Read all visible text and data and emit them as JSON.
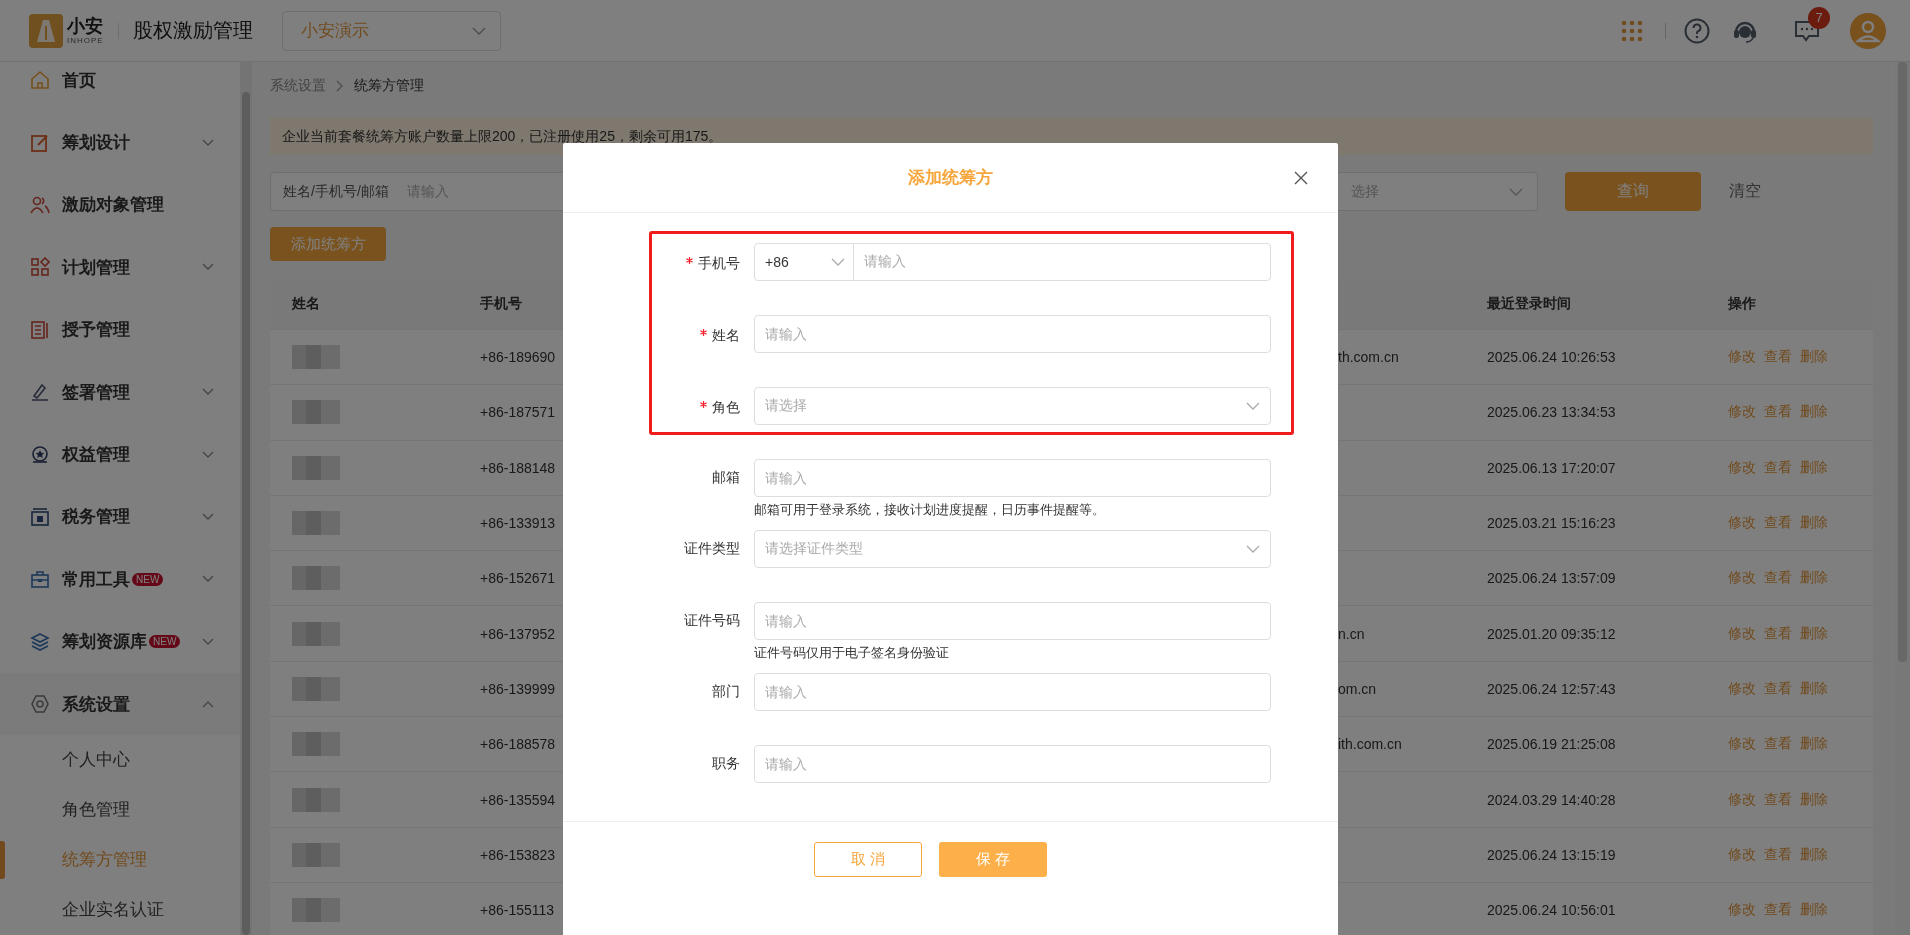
{
  "header": {
    "logo_text": "小安",
    "logo_subtext": "INHOPE",
    "app_title": "股权激励管理",
    "company_select": {
      "value": "小安演示"
    },
    "message_count": "7"
  },
  "sidebar": {
    "items": [
      {
        "label": "首页"
      },
      {
        "label": "筹划设计",
        "expanded": false
      },
      {
        "label": "激励对象管理"
      },
      {
        "label": "计划管理",
        "expanded": false
      },
      {
        "label": "授予管理"
      },
      {
        "label": "签署管理",
        "expanded": false
      },
      {
        "label": "权益管理",
        "expanded": false
      },
      {
        "label": "税务管理",
        "expanded": false
      },
      {
        "label": "常用工具",
        "badge": "NEW",
        "expanded": false
      },
      {
        "label": "筹划资源库",
        "badge": "NEW",
        "expanded": false
      },
      {
        "label": "系统设置",
        "expanded": true,
        "children": [
          {
            "label": "个人中心",
            "selected": false
          },
          {
            "label": "角色管理",
            "selected": false
          },
          {
            "label": "统筹方管理",
            "selected": true
          },
          {
            "label": "企业实名认证",
            "selected": false
          }
        ]
      }
    ]
  },
  "breadcrumb": [
    "系统设置",
    "统筹方管理"
  ],
  "notice": "企业当前套餐统筹方账户数量上限200，已注册使用25，剩余可用175。",
  "filters": {
    "search_label": "姓名/手机号/邮箱",
    "search_placeholder": "请输入",
    "select_placeholder": "选择",
    "query_button": "查询",
    "clear_button": "清空"
  },
  "add_button": "添加统筹方",
  "table": {
    "columns": {
      "name": "姓名",
      "phone": "手机号",
      "last_login": "最近登录时间",
      "actions": "操作"
    },
    "rows": [
      {
        "phone": "+86-189690",
        "email": "th.com.cn",
        "last_login": "2025.06.24 10:26:53",
        "actions": [
          "修改",
          "查看",
          "删除"
        ]
      },
      {
        "phone": "+86-187571",
        "last_login": "2025.06.23 13:34:53",
        "actions": [
          "修改",
          "查看",
          "删除"
        ]
      },
      {
        "phone": "+86-188148",
        "last_login": "2025.06.13 17:20:07",
        "actions": [
          "修改",
          "查看",
          "删除"
        ]
      },
      {
        "phone": "+86-133913",
        "last_login": "2025.03.21 15:16:23",
        "actions": [
          "修改",
          "查看",
          "删除"
        ]
      },
      {
        "phone": "+86-152671",
        "last_login": "2025.06.24 13:57:09",
        "actions": [
          "修改",
          "查看",
          "删除"
        ]
      },
      {
        "phone": "+86-137952",
        "email": "n.cn",
        "last_login": "2025.01.20 09:35:12",
        "actions": [
          "修改",
          "查看",
          "删除"
        ]
      },
      {
        "phone": "+86-139999",
        "email": "om.cn",
        "last_login": "2025.06.24 12:57:43",
        "actions": [
          "修改",
          "查看",
          "删除"
        ]
      },
      {
        "phone": "+86-188578",
        "email": "ith.com.cn",
        "last_login": "2025.06.19 21:25:08",
        "actions": [
          "修改",
          "查看",
          "删除"
        ]
      },
      {
        "phone": "+86-135594",
        "last_login": "2024.03.29 14:40:28",
        "actions": [
          "修改",
          "查看",
          "删除"
        ]
      },
      {
        "phone": "+86-153823",
        "last_login": "2025.06.24 13:15:19",
        "actions": [
          "修改",
          "查看",
          "删除"
        ]
      },
      {
        "phone": "+86-155113",
        "last_login": "2025.06.24 10:56:01",
        "actions": [
          "修改",
          "查看",
          "删除"
        ]
      }
    ]
  },
  "dialog": {
    "title": "添加统筹方",
    "fields": [
      {
        "kind": "phone",
        "label": "手机号",
        "required": true,
        "code": "+86",
        "placeholder": "请输入"
      },
      {
        "kind": "text",
        "label": "姓名",
        "required": true,
        "placeholder": "请输入"
      },
      {
        "kind": "select",
        "label": "角色",
        "required": true,
        "placeholder": "请选择"
      },
      {
        "kind": "text",
        "label": "邮箱",
        "required": false,
        "placeholder": "请输入",
        "help": "邮箱可用于登录系统，接收计划进度提醒，日历事件提醒等。"
      },
      {
        "kind": "select",
        "label": "证件类型",
        "required": false,
        "placeholder": "请选择证件类型"
      },
      {
        "kind": "text",
        "label": "证件号码",
        "required": false,
        "placeholder": "请输入",
        "help": "证件号码仅用于电子签名身份验证"
      },
      {
        "kind": "text",
        "label": "部门",
        "required": false,
        "placeholder": "请输入"
      },
      {
        "kind": "text",
        "label": "职务",
        "required": false,
        "placeholder": "请输入"
      }
    ],
    "buttons": [
      "取 消",
      "保 存"
    ]
  }
}
